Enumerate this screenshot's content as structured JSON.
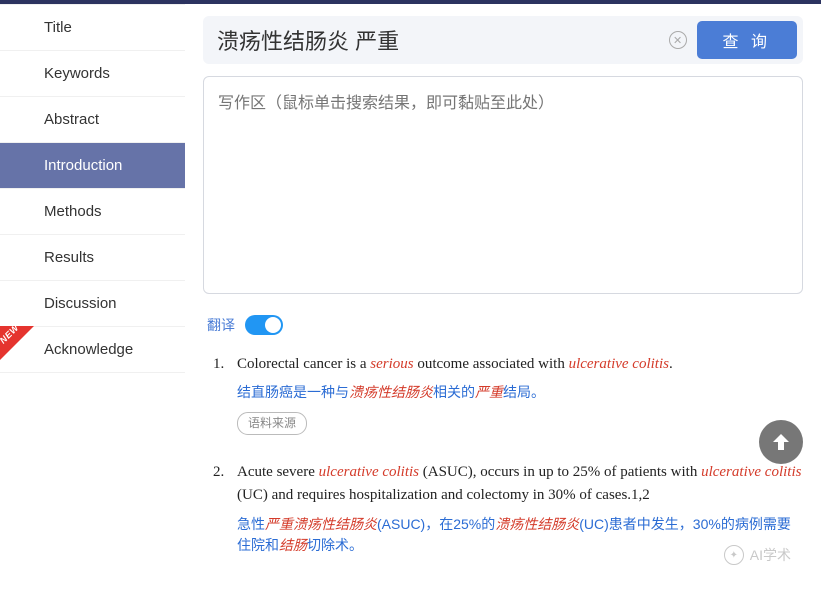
{
  "sidebar": {
    "items": [
      {
        "label": "Title"
      },
      {
        "label": "Keywords"
      },
      {
        "label": "Abstract"
      },
      {
        "label": "Introduction",
        "active": true
      },
      {
        "label": "Methods"
      },
      {
        "label": "Results"
      },
      {
        "label": "Discussion"
      },
      {
        "label": "Acknowledge",
        "new": true
      }
    ],
    "new_badge": "NEW"
  },
  "search": {
    "value": "溃疡性结肠炎 严重",
    "button": "查 询"
  },
  "write_area": {
    "placeholder": "写作区（鼠标单击搜索结果，即可黏贴至此处）"
  },
  "translate": {
    "label": "翻译",
    "on": true
  },
  "results": [
    {
      "num": "1.",
      "en_parts": [
        "Colorectal cancer is a ",
        "serious",
        " outcome associated with ",
        "ulcerative colitis",
        "."
      ],
      "zh_parts": [
        "结直肠癌是一种与",
        "溃疡性结肠炎",
        "相关的",
        "严重",
        "结局。"
      ],
      "source": "语料来源"
    },
    {
      "num": "2.",
      "en_parts": [
        "Acute severe ",
        "ulcerative colitis",
        " (ASUC), occurs in up to 25% of patients with ",
        "ulcerative colitis",
        " (UC) and requires hospitalization and colectomy in 30% of cases.1,2"
      ],
      "zh_parts": [
        "急性",
        "严重溃疡性结肠炎",
        "(ASUC)，在25%的",
        "溃疡性结肠炎",
        "(UC)患者中发生，30%的病例需要住院和",
        "结肠",
        "切除术。"
      ]
    }
  ],
  "watermark": "AI学术"
}
